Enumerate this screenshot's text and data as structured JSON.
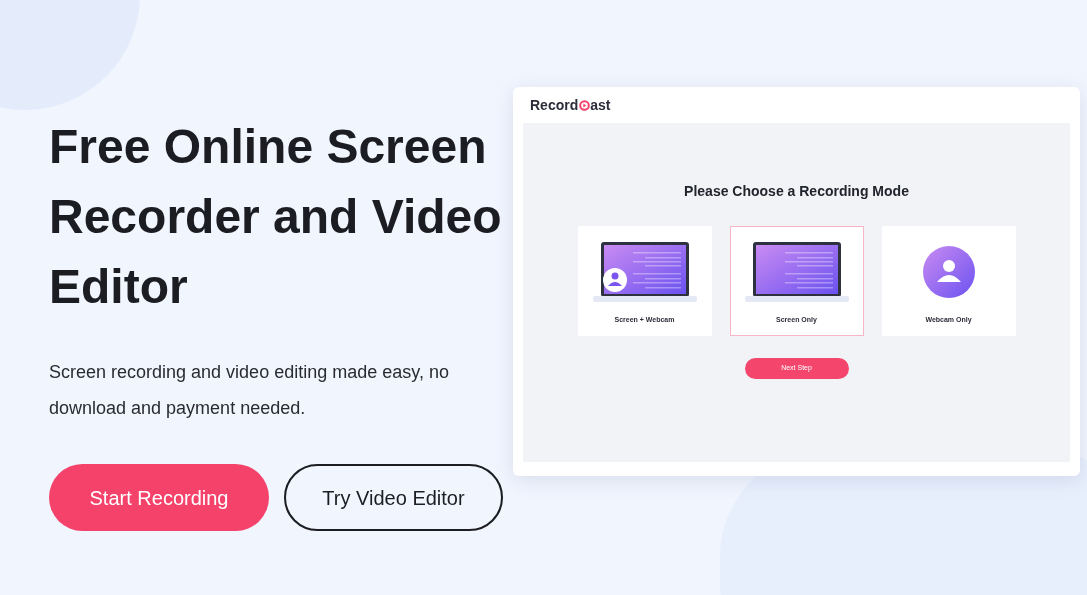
{
  "hero": {
    "title": "Free Online Screen Recorder and Video Editor",
    "subtitle": "Screen recording and video editing made easy, no download and payment needed.",
    "buttons": [
      {
        "label": "Start Recording",
        "kind": "primary"
      },
      {
        "label": "Try Video Editor",
        "kind": "outline"
      }
    ]
  },
  "preview": {
    "logo": [
      "Record",
      "ast"
    ],
    "heading": "Please Choose a Recording Mode",
    "modes": [
      {
        "label": "Screen + Webcam",
        "kind": "screen_webcam",
        "selected": false
      },
      {
        "label": "Screen Only",
        "kind": "screen",
        "selected": true
      },
      {
        "label": "Webcam Only",
        "kind": "webcam",
        "selected": false
      }
    ],
    "next_button": "Next Step"
  }
}
